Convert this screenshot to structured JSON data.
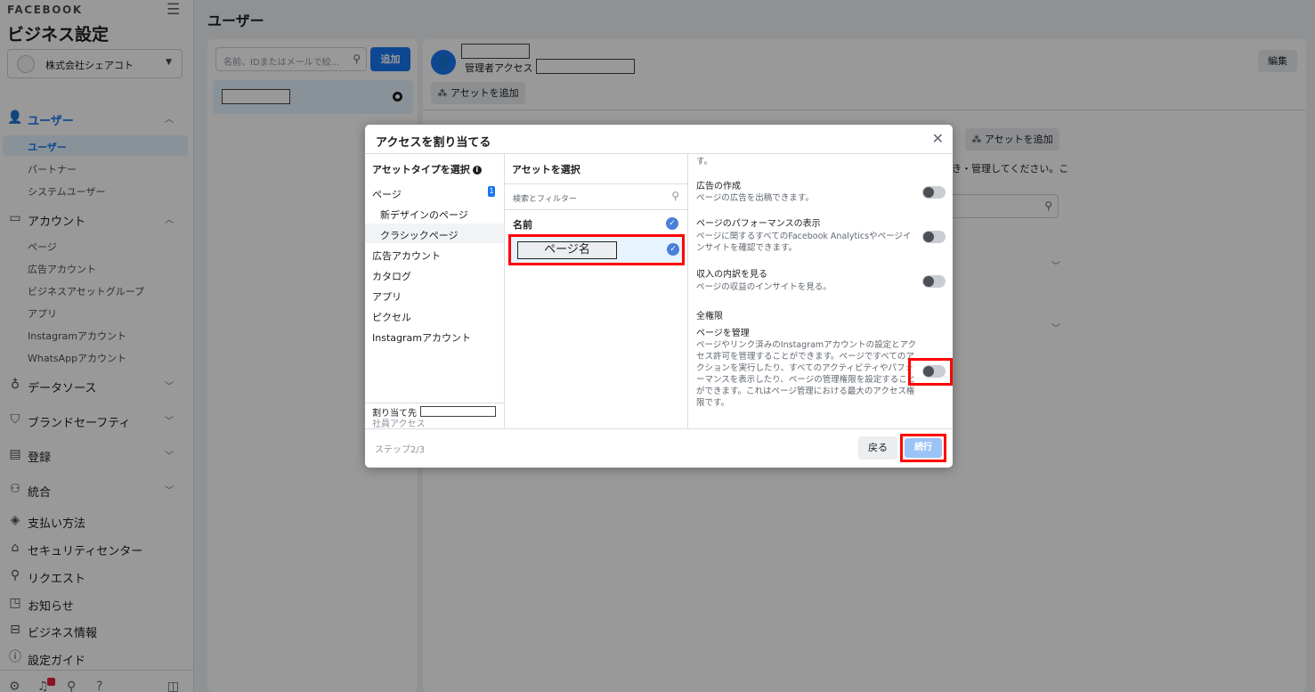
{
  "sidebar": {
    "brand": "FACEBOOK",
    "title": "ビジネス設定",
    "account": "株式会社シェアコト",
    "sections": [
      {
        "label": "ユーザー",
        "icon": "users-icon"
      },
      {
        "label": "アカウント",
        "icon": "account-icon"
      },
      {
        "label": "データソース",
        "icon": "data-source-icon"
      },
      {
        "label": "ブランドセーフティ",
        "icon": "shield-icon"
      },
      {
        "label": "登録",
        "icon": "clipboard-icon"
      },
      {
        "label": "統合",
        "icon": "integration-icon"
      },
      {
        "label": "支払い方法",
        "icon": "payment-icon"
      },
      {
        "label": "セキュリティセンター",
        "icon": "lock-icon"
      },
      {
        "label": "リクエスト",
        "icon": "request-icon"
      },
      {
        "label": "お知らせ",
        "icon": "notification-icon"
      },
      {
        "label": "ビジネス情報",
        "icon": "briefcase-icon"
      },
      {
        "label": "設定ガイド",
        "icon": "help-icon"
      }
    ],
    "user_items": [
      "ユーザー",
      "パートナー",
      "システムユーザー"
    ],
    "account_items": [
      "ページ",
      "広告アカウント",
      "ビジネスアセットグループ",
      "アプリ",
      "Instagramアカウント",
      "WhatsAppアカウント"
    ]
  },
  "main": {
    "title": "ユーザー",
    "search_placeholder": "名前、IDまたはメールで絞...",
    "add_label": "追加",
    "admin_access": "管理者アクセス",
    "add_asset": "アセットを追加",
    "edit": "編集",
    "bg_text": "き・管理してください。こ"
  },
  "modal": {
    "title": "アクセスを割り当てる",
    "col1_header": "アセットタイプを選択",
    "asset_types": [
      {
        "label": "ページ",
        "count": "1"
      },
      {
        "label": "新デザインのページ"
      },
      {
        "label": "クラシックページ"
      },
      {
        "label": "広告アカウント"
      },
      {
        "label": "カタログ"
      },
      {
        "label": "アプリ"
      },
      {
        "label": "ピクセル"
      },
      {
        "label": "Instagramアカウント"
      }
    ],
    "assign_to": "割り当て先",
    "employee_access": "社員アクセス",
    "col2_header": "アセットを選択",
    "search_placeholder": "検索とフィルター",
    "name_header": "名前",
    "page_name": "ページ名",
    "top_fragment": "す。",
    "permissions": [
      {
        "title": "広告の作成",
        "desc": "ページの広告を出稿できます。"
      },
      {
        "title": "ページのパフォーマンスの表示",
        "desc": "ページに関するすべてのFacebook Analyticsやページインサイトを確認できます。"
      },
      {
        "title": "収入の内訳を見る",
        "desc": "ページの収益のインサイトを見る。"
      }
    ],
    "full_permission_label": "全権限",
    "manage_page": {
      "title": "ページを管理",
      "desc": "ページやリンク済みのInstagramアカウントの設定とアクセス許可を管理することができます。ページですべてのアクションを実行したり、すべてのアクティビティやパフォーマンスを表示したり、ページの管理権限を設定することができます。これはページ管理における最大のアクセス権限です。"
    },
    "step": "ステップ2/3",
    "back": "戻る",
    "next": "続行"
  }
}
